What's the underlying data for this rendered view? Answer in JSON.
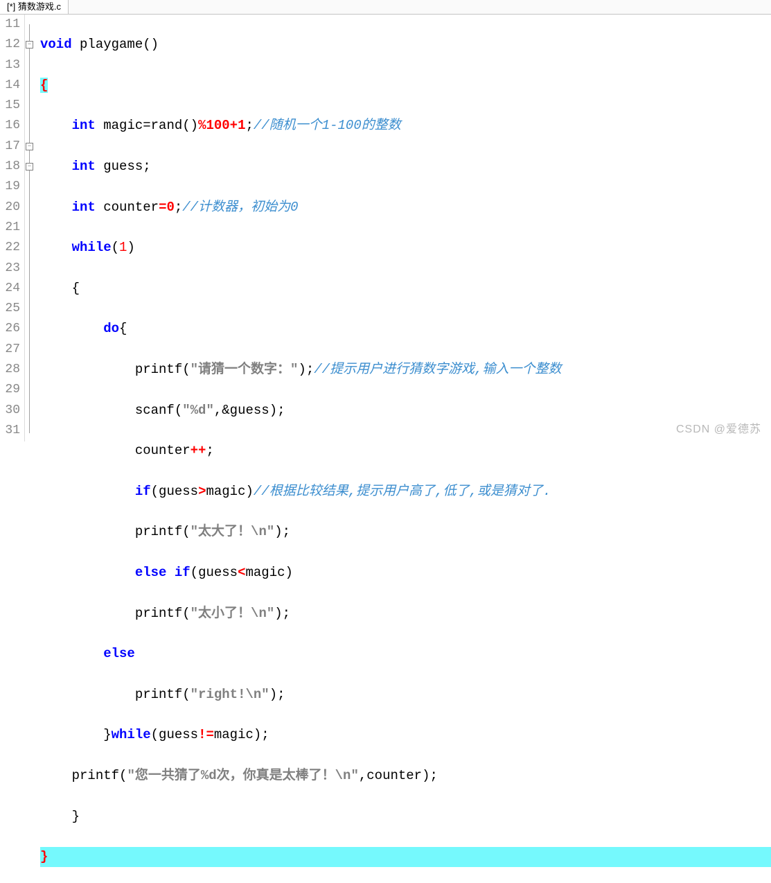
{
  "tab": {
    "title": "[*] 猜数游戏.c"
  },
  "lines": {
    "start": 11,
    "count": 21
  },
  "code": {
    "void": "void",
    "int": "int",
    "while": "while",
    "do": "do",
    "if": "if",
    "else": "else",
    "playgame": "playgame",
    "magic": "magic",
    "rand": "rand",
    "guess": "guess",
    "counter": "counter",
    "printf": "printf",
    "scanf": "scanf",
    "assign_rand": "=rand",
    "mod100plus1": "%100+1",
    "eq0": "=0",
    "one": "1",
    "pp": "++",
    "gt": ">",
    "lt": "<",
    "ne": "!=",
    "rand_after": ";",
    "cmt_rand": "//随机一个1-100的整数",
    "cmt_counter": "//计数器，初始为0",
    "cmt_prompt": "//提示用户进行猜数字游戏,输入一个整数",
    "cmt_compare": "//根据比较结果,提示用户高了,低了,或是猜对了.",
    "str_prompt": "\"请猜一个数字：\"",
    "str_fmt_d": "\"%d\"",
    "str_too_big": "\"太大了！\\n\"",
    "str_too_small": "\"太小了！\\n\"",
    "str_right": "\"right!\\n\"",
    "str_final": "\"您一共猜了%d次，你真是太棒了！\\n\"",
    "amp_guess": ",&guess",
    "comma_counter": ",counter"
  },
  "watermark": "CSDN @爱德苏"
}
